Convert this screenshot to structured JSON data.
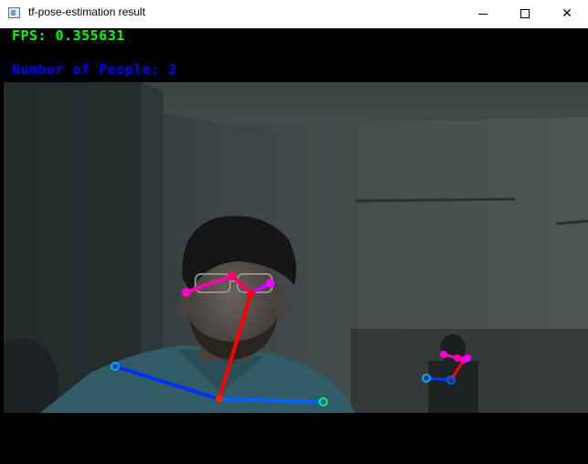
{
  "window": {
    "title": "tf-pose-estimation result",
    "controls": {
      "minimize_icon": "minimize-icon",
      "maximize_icon": "maximize-icon",
      "close_icon": "close-icon",
      "close_glyph": "✕"
    }
  },
  "overlay": {
    "fps_text": "FPS: 0.355631",
    "people_text": "Number of People: 2",
    "fps_color": "#00ff00",
    "people_color": "#0000ff"
  },
  "pose": {
    "people_count": 2,
    "limb_colors": {
      "neck": "#ff0000",
      "shoulder": "#0040ff",
      "face_right": "#ff00aa",
      "face_left": "#cc00ff"
    }
  }
}
